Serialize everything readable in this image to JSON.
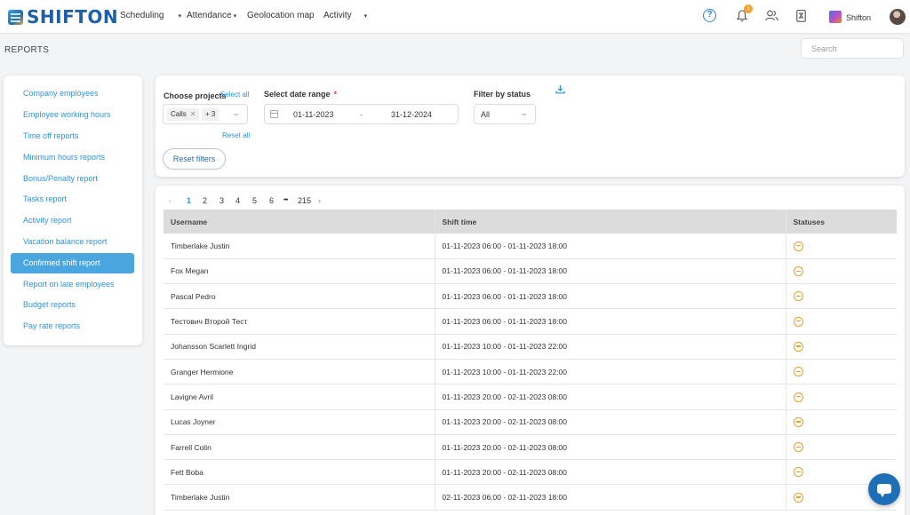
{
  "brand": {
    "name": "SHIFTON"
  },
  "nav": [
    {
      "label": "Scheduling",
      "caret": "▾"
    },
    {
      "label": "Attendance",
      "caret": "▾"
    },
    {
      "label": "Geolocation map",
      "caret": ""
    },
    {
      "label": "Activity",
      "caret": "▾"
    }
  ],
  "header": {
    "help_glyph": "?",
    "notifications_count": "1",
    "company_name": "Shifton"
  },
  "page": {
    "title": "REPORTS",
    "search_placeholder": "Search"
  },
  "sidebar": {
    "active": "Confirmed shift report",
    "items": [
      "Company employees",
      "Employee working hours",
      "Time off reports",
      "Minimum hours reports",
      "Bonus/Penalty report",
      "Tasks report",
      "Activity report",
      "Vacation balance report",
      "Confirmed shift report",
      "Report on late employees",
      "Budget reports",
      "Pay rate reports"
    ]
  },
  "filters": {
    "projects_label": "Choose projects",
    "select_all": "Select all",
    "reset_all": "Reset all",
    "project_chip": "Calls",
    "project_more": "+ 3",
    "date_label": "Select date range",
    "date_required": "*",
    "date_from": "01-11-2023",
    "date_separator": "-",
    "date_to": "31-12-2024",
    "status_label": "Filter by status",
    "status_value": "All",
    "reset_filters": "Reset filters"
  },
  "pagination": {
    "prev": "‹",
    "next": "›",
    "pages": [
      "1",
      "2",
      "3",
      "4",
      "5",
      "6"
    ],
    "ellipsis": "•••",
    "last": "215",
    "current": "1"
  },
  "table": {
    "columns": [
      "Username",
      "Shift time",
      "Statuses"
    ],
    "rows": [
      {
        "username": "Timberlake Justin",
        "shift": "01-11-2023 06:00 - 01-11-2023 18:00",
        "status": "pending"
      },
      {
        "username": "Fox Megan",
        "shift": "01-11-2023 06:00 - 01-11-2023 18:00",
        "status": "pending"
      },
      {
        "username": "Pascal Pedro",
        "shift": "01-11-2023 06:00 - 01-11-2023 18:00",
        "status": "pending"
      },
      {
        "username": "Тестович Второй Тест",
        "shift": "01-11-2023 06:00 - 01-11-2023 18:00",
        "status": "pending"
      },
      {
        "username": "Johansson Scarlett Ingrid",
        "shift": "01-11-2023 10:00 - 01-11-2023 22:00",
        "status": "pending"
      },
      {
        "username": "Granger Hermione",
        "shift": "01-11-2023 10:00 - 01-11-2023 22:00",
        "status": "pending"
      },
      {
        "username": "Lavigne Avril",
        "shift": "01-11-2023 20:00 - 02-11-2023 08:00",
        "status": "pending"
      },
      {
        "username": "Lucas Joyner",
        "shift": "01-11-2023 20:00 - 02-11-2023 08:00",
        "status": "pending"
      },
      {
        "username": "Farrell Colin",
        "shift": "01-11-2023 20:00 - 02-11-2023 08:00",
        "status": "pending"
      },
      {
        "username": "Fett Boba",
        "shift": "01-11-2023 20:00 - 02-11-2023 08:00",
        "status": "pending"
      },
      {
        "username": "Timberlake Justin",
        "shift": "02-11-2023 06:00 - 02-11-2023 18:00",
        "status": "pending"
      }
    ]
  },
  "colors": {
    "brand": "#1f5fa8",
    "accent": "#2e93d5",
    "active_item": "#4ba6e0",
    "status_pending": "#e3a12f",
    "chat": "#1f6fb8"
  }
}
